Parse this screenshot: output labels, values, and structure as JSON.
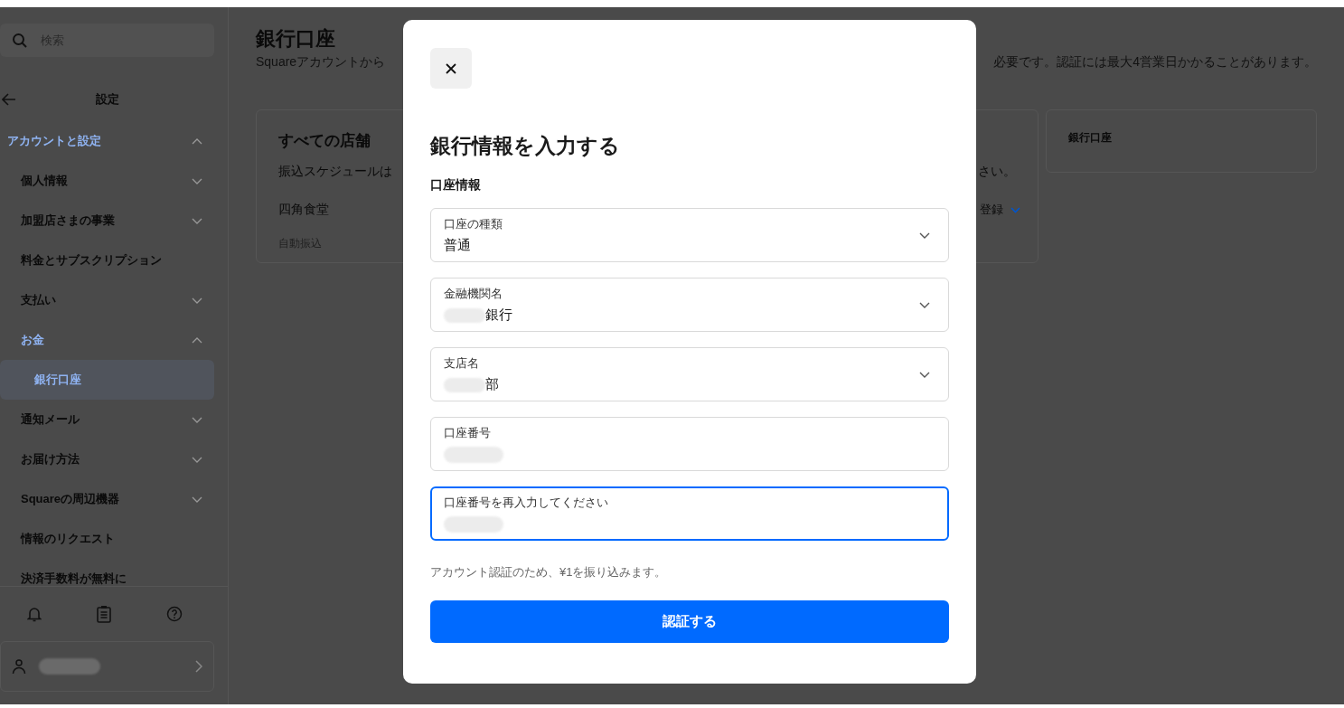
{
  "sidebar": {
    "search": {
      "placeholder": "検索"
    },
    "header": {
      "title": "設定"
    },
    "items": [
      {
        "label": "アカウントと設定",
        "expanded": true,
        "selected": false,
        "children": [
          {
            "label": "個人情報",
            "expanded": false,
            "selected": false
          },
          {
            "label": "加盟店さまの事業",
            "expanded": false,
            "selected": false
          },
          {
            "label": "料金とサブスクリプション",
            "selected": false
          },
          {
            "label": "支払い",
            "expanded": false,
            "selected": false
          },
          {
            "label": "お金",
            "expanded": true,
            "selected": false,
            "children": [
              {
                "label": "銀行口座",
                "selected": true
              }
            ]
          },
          {
            "label": "通知メール",
            "expanded": false,
            "selected": false
          },
          {
            "label": "お届け方法",
            "expanded": false,
            "selected": false
          },
          {
            "label": "Squareの周辺機器",
            "expanded": false,
            "selected": false
          },
          {
            "label": "情報のリクエスト",
            "selected": false
          },
          {
            "label": "決済手数料が無料に",
            "selected": false
          }
        ]
      }
    ],
    "account": {
      "redacted": true
    }
  },
  "page": {
    "title": "銀行口座",
    "subtitle_start": "Squareアカウントから",
    "subtitle_end": "必要です。認証には最大4営業日かかることがあります。",
    "card": {
      "title": "すべての店舗",
      "text_start": "振込スケジュールは",
      "text_end": "さい。",
      "location": "四角食堂",
      "transfer": "自動振込",
      "action": "登録"
    },
    "side_card": {
      "title": "銀行口座"
    }
  },
  "modal": {
    "title": "銀行情報を入力する",
    "section": "口座情報",
    "fields": [
      {
        "kind": "select",
        "label": "口座の種類",
        "value": "普通",
        "redacted": false,
        "focused": false
      },
      {
        "kind": "select",
        "label": "金融機関名",
        "value": "銀行",
        "redacted": true,
        "focused": false
      },
      {
        "kind": "select",
        "label": "支店名",
        "value": "部",
        "redacted": true,
        "focused": false
      },
      {
        "kind": "text",
        "label": "口座番号",
        "redacted": true,
        "focused": false
      },
      {
        "kind": "text",
        "label": "口座番号を再入力してください",
        "redacted": true,
        "focused": true
      }
    ],
    "note": "アカウント認証のため、¥1を振り込みます。",
    "submit": "認証する"
  }
}
